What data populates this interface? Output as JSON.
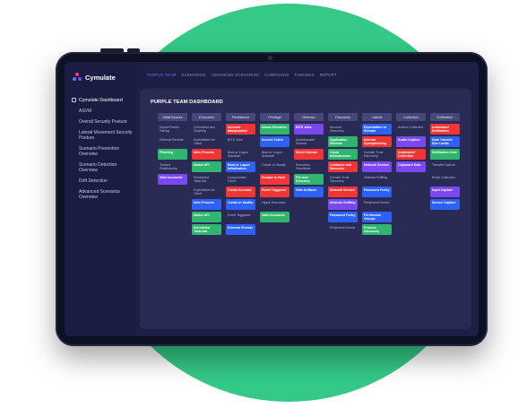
{
  "brand": {
    "name": "Cymulate"
  },
  "sidebar": {
    "items": [
      {
        "label": "Cymulate Dashboard"
      },
      {
        "label": "ASVM"
      },
      {
        "label": "Overall Security Posture"
      },
      {
        "label": "Lateral Movement Security Posture"
      },
      {
        "label": "Scenario Prevention Overview"
      },
      {
        "label": "Scenario Detection Overview"
      },
      {
        "label": "Drift Detection"
      },
      {
        "label": "Advanced Scenarios Overview"
      }
    ]
  },
  "tabs": [
    {
      "label": "PURPLE TEAM"
    },
    {
      "label": "SCENARIOS"
    },
    {
      "label": "ADVANCED SCENARIOS"
    },
    {
      "label": "CAMPAIGNS"
    },
    {
      "label": "FINDINGS"
    },
    {
      "label": "REPORT"
    }
  ],
  "panel": {
    "title": "PURPLE TEAM DASHBOARD"
  },
  "colors": {
    "red": "#f13535",
    "green": "#2fb56d",
    "purple": "#7b47f0",
    "blue": "#2d61f6",
    "neutral": "#393b6a",
    "accent": "#5b7bff",
    "circle": "#34c987"
  },
  "matrix": [
    [
      {
        "label": "Initial Access",
        "style": "header"
      },
      {
        "label": "Exploit Public-Facing",
        "style": "plain"
      },
      {
        "label": "External Remote",
        "style": "plain"
      },
      {
        "label": "Phishing",
        "style": "green"
      },
      {
        "label": "Trusted Relationship",
        "style": "plain"
      },
      {
        "label": "Valid Accounts",
        "style": "purple"
      }
    ],
    [
      {
        "label": "Execution",
        "style": "header"
      },
      {
        "label": "Command and Scripting",
        "style": "plain"
      },
      {
        "label": "Exploitation for Client",
        "style": "plain"
      },
      {
        "label": "Inter-Process",
        "style": "red"
      },
      {
        "label": "Native API",
        "style": "green"
      },
      {
        "label": "Scheduled Task/Job",
        "style": "plain"
      },
      {
        "label": "Exploitation for Client",
        "style": "plain"
      },
      {
        "label": "Inter-Process",
        "style": "blue"
      },
      {
        "label": "Native API",
        "style": "green"
      },
      {
        "label": "Scheduled Task/Job",
        "style": "green"
      }
    ],
    [
      {
        "label": "Persistence",
        "style": "header"
      },
      {
        "label": "Account Manipulation",
        "style": "red"
      },
      {
        "label": "BITS Jobs",
        "style": "plain"
      },
      {
        "label": "Boot or Logon Autostart",
        "style": "plain"
      },
      {
        "label": "Boot or Logon Initialization",
        "style": "blue"
      },
      {
        "label": "Compromise Client",
        "style": "plain"
      },
      {
        "label": "Create Account",
        "style": "red"
      },
      {
        "label": "Create or Modify",
        "style": "blue"
      },
      {
        "label": "Event Triggered",
        "style": "plain"
      },
      {
        "label": "External Remote",
        "style": "blue"
      }
    ],
    [
      {
        "label": "Privilege",
        "style": "header"
      },
      {
        "label": "Abuse Elevation",
        "style": "green"
      },
      {
        "label": "Access Token",
        "style": "blue"
      },
      {
        "label": "Boot or Logon Autostart",
        "style": "plain"
      },
      {
        "label": "Create or Modify",
        "style": "plain"
      },
      {
        "label": "Escape to Host",
        "style": "red"
      },
      {
        "label": "Event Triggered",
        "style": "red"
      },
      {
        "label": "Hijack Execution",
        "style": "plain"
      },
      {
        "label": "Valid Accounts",
        "style": "green"
      }
    ],
    [
      {
        "label": "Defense",
        "style": "header"
      },
      {
        "label": "BITS Jobs",
        "style": "purple"
      },
      {
        "label": "Deobfuscate/ Decode",
        "style": "plain"
      },
      {
        "label": "Direct Volume",
        "style": "red"
      },
      {
        "label": "Execution Guardrails",
        "style": "plain"
      },
      {
        "label": "File and Directory",
        "style": "green"
      },
      {
        "label": "Hide Artifacts",
        "style": "blue"
      }
    ],
    [
      {
        "label": "Discovery",
        "style": "header"
      },
      {
        "label": "Account Discovery",
        "style": "plain"
      },
      {
        "label": "Application Window",
        "style": "green"
      },
      {
        "label": "Cloud Infrastructure",
        "style": "green"
      },
      {
        "label": "Container and Resource",
        "style": "red"
      },
      {
        "label": "Domain Trust Discovery",
        "style": "plain"
      },
      {
        "label": "Network Service",
        "style": "red"
      },
      {
        "label": "Network Sniffing",
        "style": "purple"
      },
      {
        "label": "Password Policy",
        "style": "blue"
      },
      {
        "label": "Peripheral Device",
        "style": "plain"
      }
    ],
    [
      {
        "label": "Lateral",
        "style": "header"
      },
      {
        "label": "Exploitation of Remote",
        "style": "blue"
      },
      {
        "label": "Internal Spearphishing",
        "style": "red"
      },
      {
        "label": "Domain Trust Discovery",
        "style": "plain"
      },
      {
        "label": "Network Service",
        "style": "purple"
      },
      {
        "label": "Network Sniffing",
        "style": "plain"
      },
      {
        "label": "Password Policy",
        "style": "blue"
      },
      {
        "label": "Peripheral Device",
        "style": "plain"
      },
      {
        "label": "Permission Groups",
        "style": "blue"
      },
      {
        "label": "Process Discovery",
        "style": "green"
      }
    ],
    [
      {
        "label": "Collection",
        "style": "header"
      },
      {
        "label": "Archive Collected",
        "style": "plain"
      },
      {
        "label": "Audio Capture",
        "style": "purple"
      },
      {
        "label": "Automated Collection",
        "style": "red"
      },
      {
        "label": "Clipboard Data",
        "style": "purple"
      }
    ],
    [
      {
        "label": "Exfiltration",
        "style": "header"
      },
      {
        "label": "Automated Exfiltration",
        "style": "red"
      },
      {
        "label": "Data Transfer Size Limits",
        "style": "blue"
      },
      {
        "label": "Exfiltration Over",
        "style": "green"
      },
      {
        "label": "Transfer Data to",
        "style": "plain"
      },
      {
        "label": "Email Collection",
        "style": "plain"
      },
      {
        "label": "Input Capture",
        "style": "purple"
      },
      {
        "label": "Screen Capture",
        "style": "blue"
      }
    ]
  ]
}
